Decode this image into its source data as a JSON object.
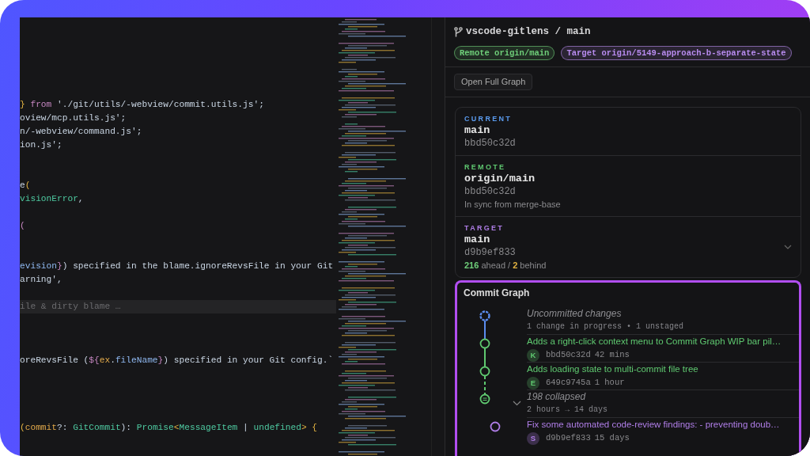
{
  "editor": {
    "lines": [
      {
        "kind": "blank"
      },
      {
        "kind": "blank"
      },
      {
        "kind": "blank"
      },
      {
        "kind": "blank"
      },
      {
        "kind": "blank"
      },
      {
        "kind": "blank"
      },
      {
        "kind": "code",
        "segments": [
          {
            "kind": "bracket",
            "text": "}"
          },
          {
            "kind": "keyword",
            "text": " from"
          },
          {
            "kind": "plain",
            "text": " './git/utils/-webview/commit.utils.js';"
          }
        ]
      },
      {
        "kind": "code",
        "segments": [
          {
            "kind": "plain",
            "text": "oview/mcp.utils.js';"
          }
        ]
      },
      {
        "kind": "code",
        "segments": [
          {
            "kind": "plain",
            "text": "n/-webview/command.js';"
          }
        ]
      },
      {
        "kind": "code",
        "segments": [
          {
            "kind": "plain",
            "text": "ion.js';"
          }
        ]
      },
      {
        "kind": "blank"
      },
      {
        "kind": "blank"
      },
      {
        "kind": "code",
        "segments": [
          {
            "kind": "plain",
            "text": "e"
          },
          {
            "kind": "bracket",
            "text": "("
          }
        ]
      },
      {
        "kind": "code",
        "segments": [
          {
            "kind": "type",
            "text": "visionError"
          },
          {
            "kind": "plain",
            "text": ","
          }
        ]
      },
      {
        "kind": "blank"
      },
      {
        "kind": "code",
        "segments": [
          {
            "kind": "keyword",
            "text": "("
          }
        ]
      },
      {
        "kind": "blank"
      },
      {
        "kind": "blank"
      },
      {
        "kind": "code",
        "segments": [
          {
            "kind": "variable",
            "text": "evision"
          },
          {
            "kind": "keyword",
            "text": "}"
          },
          {
            "kind": "plain",
            "text": ") specified in the blame.ignoreRevsFile in your Git"
          }
        ]
      },
      {
        "kind": "code",
        "segments": [
          {
            "kind": "plain",
            "text": "arning',"
          }
        ]
      },
      {
        "kind": "blank"
      },
      {
        "kind": "ghost",
        "segments": [
          {
            "kind": "ghost",
            "text": "ile & dirty blame …"
          }
        ]
      },
      {
        "kind": "blank"
      },
      {
        "kind": "blank"
      },
      {
        "kind": "blank"
      },
      {
        "kind": "code",
        "segments": [
          {
            "kind": "plain",
            "text": "oreRevsFile ("
          },
          {
            "kind": "keyword",
            "text": "${"
          },
          {
            "kind": "param",
            "text": "ex"
          },
          {
            "kind": "plain",
            "text": "."
          },
          {
            "kind": "variable",
            "text": "fileName"
          },
          {
            "kind": "keyword",
            "text": "}"
          },
          {
            "kind": "plain",
            "text": ") specified in your Git config.`"
          }
        ]
      },
      {
        "kind": "blank"
      },
      {
        "kind": "blank"
      },
      {
        "kind": "blank"
      },
      {
        "kind": "blank"
      },
      {
        "kind": "code",
        "segments": [
          {
            "kind": "bracket",
            "text": "("
          },
          {
            "kind": "param",
            "text": "commit"
          },
          {
            "kind": "plain",
            "text": "?: "
          },
          {
            "kind": "type",
            "text": "GitCommit"
          },
          {
            "kind": "plain",
            "text": "): "
          },
          {
            "kind": "type",
            "text": "Promise"
          },
          {
            "kind": "bracket",
            "text": "<"
          },
          {
            "kind": "type",
            "text": "MessageItem"
          },
          {
            "kind": "plain",
            "text": " | "
          },
          {
            "kind": "type",
            "text": "undefined"
          },
          {
            "kind": "bracket",
            "text": ">"
          },
          {
            "kind": "bracket",
            "text": " {"
          }
        ]
      }
    ]
  },
  "panel": {
    "title": "vscode-gitlens / main",
    "pills": [
      {
        "text": "Remote origin/main",
        "color": "#6fcf7a"
      },
      {
        "text": "Target origin/5149-approach-b-separate-state",
        "color": "#b98cf0"
      }
    ],
    "open_button": "Open Full Graph",
    "branches": [
      {
        "label": "CURRENT",
        "color": "#5b9cf0",
        "name": "main",
        "sha": "bbd50c32d"
      },
      {
        "label": "REMOTE",
        "color": "#5fc970",
        "name": "origin/main",
        "sha": "bbd50c32d",
        "note": "In sync from merge-base"
      },
      {
        "label": "TARGET",
        "color": "#b07ee8",
        "name": "main",
        "sha": "d9b9ef833",
        "ahead": "216",
        "ahead_word": "ahead /",
        "behind": "2",
        "behind_word": "behind",
        "expanded": false
      }
    ],
    "graph": {
      "title": "Commit Graph",
      "rows": [
        {
          "kind": "wip",
          "color": "#5b8def",
          "title": "Uncommitted changes",
          "detail": "1 change in progress • 1 unstaged"
        },
        {
          "kind": "commit",
          "color": "#5fc970",
          "title": "Adds a right-click context menu to Commit Graph WIP bar pil…",
          "avatar": "K",
          "sha": "bbd50c32d",
          "time": "42 mins"
        },
        {
          "kind": "commit",
          "color": "#5fc970",
          "title": "Adds loading state to multi-commit file tree",
          "avatar": "E",
          "sha": "649c9745a",
          "time": "1 hour"
        },
        {
          "kind": "collapsed",
          "color": "#5fc970",
          "title": "198 collapsed",
          "detail": "2 hours → 14 days",
          "expanded": false
        },
        {
          "kind": "commit",
          "color": "#b07ee8",
          "title": "Fix some automated code-review findings: - preventing doub…",
          "avatar": "S",
          "sha": "d9b9ef833",
          "time": "15 days"
        }
      ]
    }
  }
}
